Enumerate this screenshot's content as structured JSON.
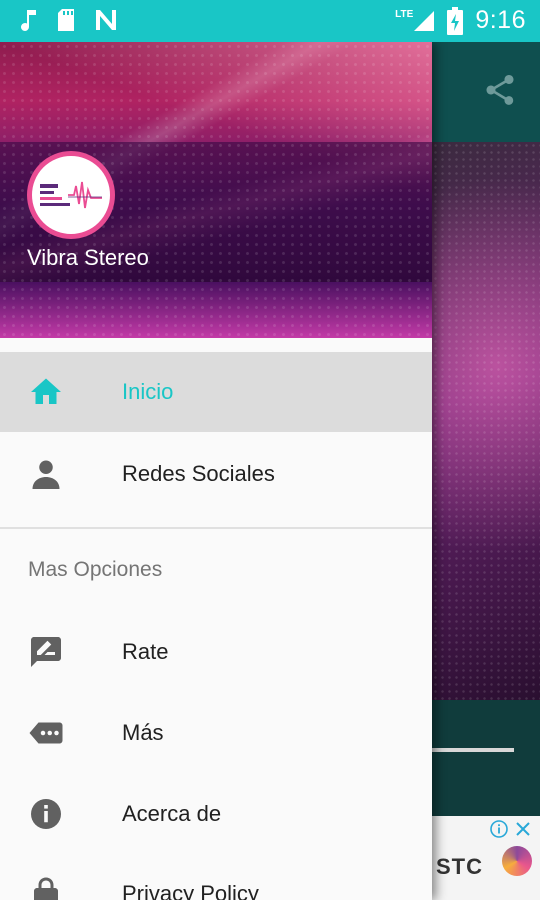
{
  "status_bar": {
    "time": "9:16",
    "network": "LTE",
    "icons": [
      "music-note-icon",
      "sd-card-icon",
      "n-app-icon",
      "signal-icon",
      "battery-charging-icon"
    ]
  },
  "drawer": {
    "header": {
      "station_name": "Vibra Stereo"
    },
    "items": [
      {
        "label": "Inicio",
        "icon": "home-icon",
        "active": true
      },
      {
        "label": "Redes Sociales",
        "icon": "person-icon",
        "active": false
      }
    ],
    "section_title": "Mas Opciones",
    "more_items": [
      {
        "label": "Rate",
        "icon": "rate-review-icon"
      },
      {
        "label": "Más",
        "icon": "label-more-icon"
      },
      {
        "label": "Acerca de",
        "icon": "info-icon"
      },
      {
        "label": "Privacy Policy",
        "icon": "lock-icon"
      }
    ]
  },
  "background_app": {
    "toolbar_icon": "share-icon",
    "ad": {
      "brand": "STC"
    }
  },
  "colors": {
    "accent": "#19c6c6",
    "status_bar": "#19c6c6",
    "active_item_bg": "#dcdcdc",
    "logo_ring": "#ea4c93"
  }
}
